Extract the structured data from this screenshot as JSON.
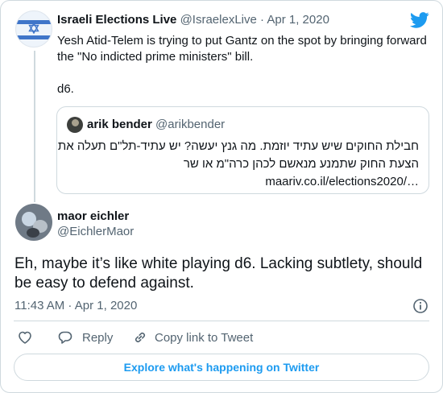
{
  "parent": {
    "name": "Israeli Elections Live",
    "handle": "@IsraelexLive",
    "date": "Apr 1, 2020",
    "separator": "·",
    "text_line1": "Yesh Atid-Telem is trying to put Gantz on the spot by bringing forward the \"No indicted prime ministers\" bill.",
    "text_line2": "d6."
  },
  "quoted": {
    "name": "arik bender",
    "handle": "@arikbender",
    "line1": "חבילת החוקים שיש עתיד יוזמת. מה גנץ יעשה? יש עתיד-תל\"ם תעלה את",
    "line2": "הצעת החוק שתמנע מנאשם לכהן כרה\"מ או שר",
    "link": "maariv.co.il/elections2020/…"
  },
  "reply": {
    "name": "maor eichler",
    "handle": "@EichlerMaor",
    "text": "Eh, maybe it’s like white playing d6. Lacking subtlety, should be easy to defend against.",
    "time": "11:43 AM · Apr 1, 2020"
  },
  "actions": {
    "reply_label": "Reply",
    "copy_label": "Copy link to Tweet"
  },
  "explore_label": "Explore what's happening on Twitter",
  "colors": {
    "accent": "#1d9bf0",
    "muted": "#536471",
    "border": "#cfd9de"
  }
}
